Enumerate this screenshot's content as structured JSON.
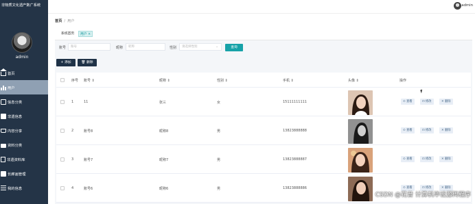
{
  "sidebar": {
    "title": "非物质文化遗产数广系统",
    "username": "admin",
    "items": [
      {
        "label": "首页",
        "icon": "home-icon"
      },
      {
        "label": "用户",
        "icon": "bar-chart-icon"
      },
      {
        "label": "信息分类",
        "icon": "category-icon"
      },
      {
        "label": "非遗信息",
        "icon": "info-icon"
      },
      {
        "label": "内容分享",
        "icon": "share-icon"
      },
      {
        "label": "资料分类",
        "icon": "folder-icon"
      },
      {
        "label": "非遗资料库",
        "icon": "library-icon"
      },
      {
        "label": "长廊画管理",
        "icon": "gallery-icon"
      },
      {
        "label": "我的信息",
        "icon": "profile-icon"
      }
    ]
  },
  "topbar": {
    "username": "admin"
  },
  "breadcrumb": {
    "home": "首页",
    "current": "用户"
  },
  "tabs": {
    "home": "系统首页",
    "user": "用户 ×"
  },
  "filters": {
    "account_label": "账号",
    "account_placeholder": "账号",
    "nickname_label": "昵称",
    "nickname_placeholder": "昵称",
    "gender_label": "性别",
    "gender_placeholder": "请选择性别",
    "search_button": "查询"
  },
  "actions": {
    "add": "+ 添加",
    "delete": "删除"
  },
  "table": {
    "headers": {
      "index": "序号",
      "account": "账号 ⇕",
      "nickname": "昵称 ⇕",
      "gender": "性别 ⇕",
      "phone": "手机 ⇕",
      "avatar": "头像 ⇕",
      "ops": "操作"
    },
    "rows": [
      {
        "index": "1",
        "account": "11",
        "nickname": "张三",
        "gender": "女",
        "phone": "15111111111",
        "photo_tone": "#c9a58c"
      },
      {
        "index": "2",
        "account": "账号8",
        "nickname": "昵称8",
        "gender": "男",
        "phone": "13823888888",
        "photo_tone": "#8a8a8a"
      },
      {
        "index": "3",
        "account": "账号7",
        "nickname": "昵称7",
        "gender": "男",
        "phone": "13823888887",
        "photo_tone": "#b07a5a"
      },
      {
        "index": "4",
        "account": "账号6",
        "nickname": "昵称6",
        "gender": "男",
        "phone": "13823888886",
        "photo_tone": "#7a5a48"
      }
    ],
    "op_labels": {
      "view": "⊙ 查看",
      "edit": "⊡ 修改",
      "delete": "✕ 删除"
    }
  },
  "watermark": "CSDN @花昔 计算机毕设源码程序"
}
